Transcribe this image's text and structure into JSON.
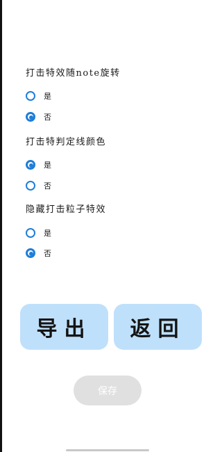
{
  "settings": {
    "rotate_effect": {
      "title": "打击特效随note旋转",
      "options": [
        {
          "label": "是",
          "checked": false
        },
        {
          "label": "否",
          "checked": true
        }
      ]
    },
    "judge_color": {
      "title": "打击特判定线颜色",
      "options": [
        {
          "label": "是",
          "checked": true
        },
        {
          "label": "否",
          "checked": false
        }
      ]
    },
    "hide_particles": {
      "title": "隐藏打击粒子特效",
      "options": [
        {
          "label": "是",
          "checked": false
        },
        {
          "label": "否",
          "checked": true
        }
      ]
    }
  },
  "actions": {
    "export_label": "导出",
    "back_label": "返回",
    "save_label": "保存"
  },
  "colors": {
    "accent": "#1e7ed9",
    "button_bg": "#bfe0fb",
    "save_disabled_bg": "#e0e0e0"
  }
}
